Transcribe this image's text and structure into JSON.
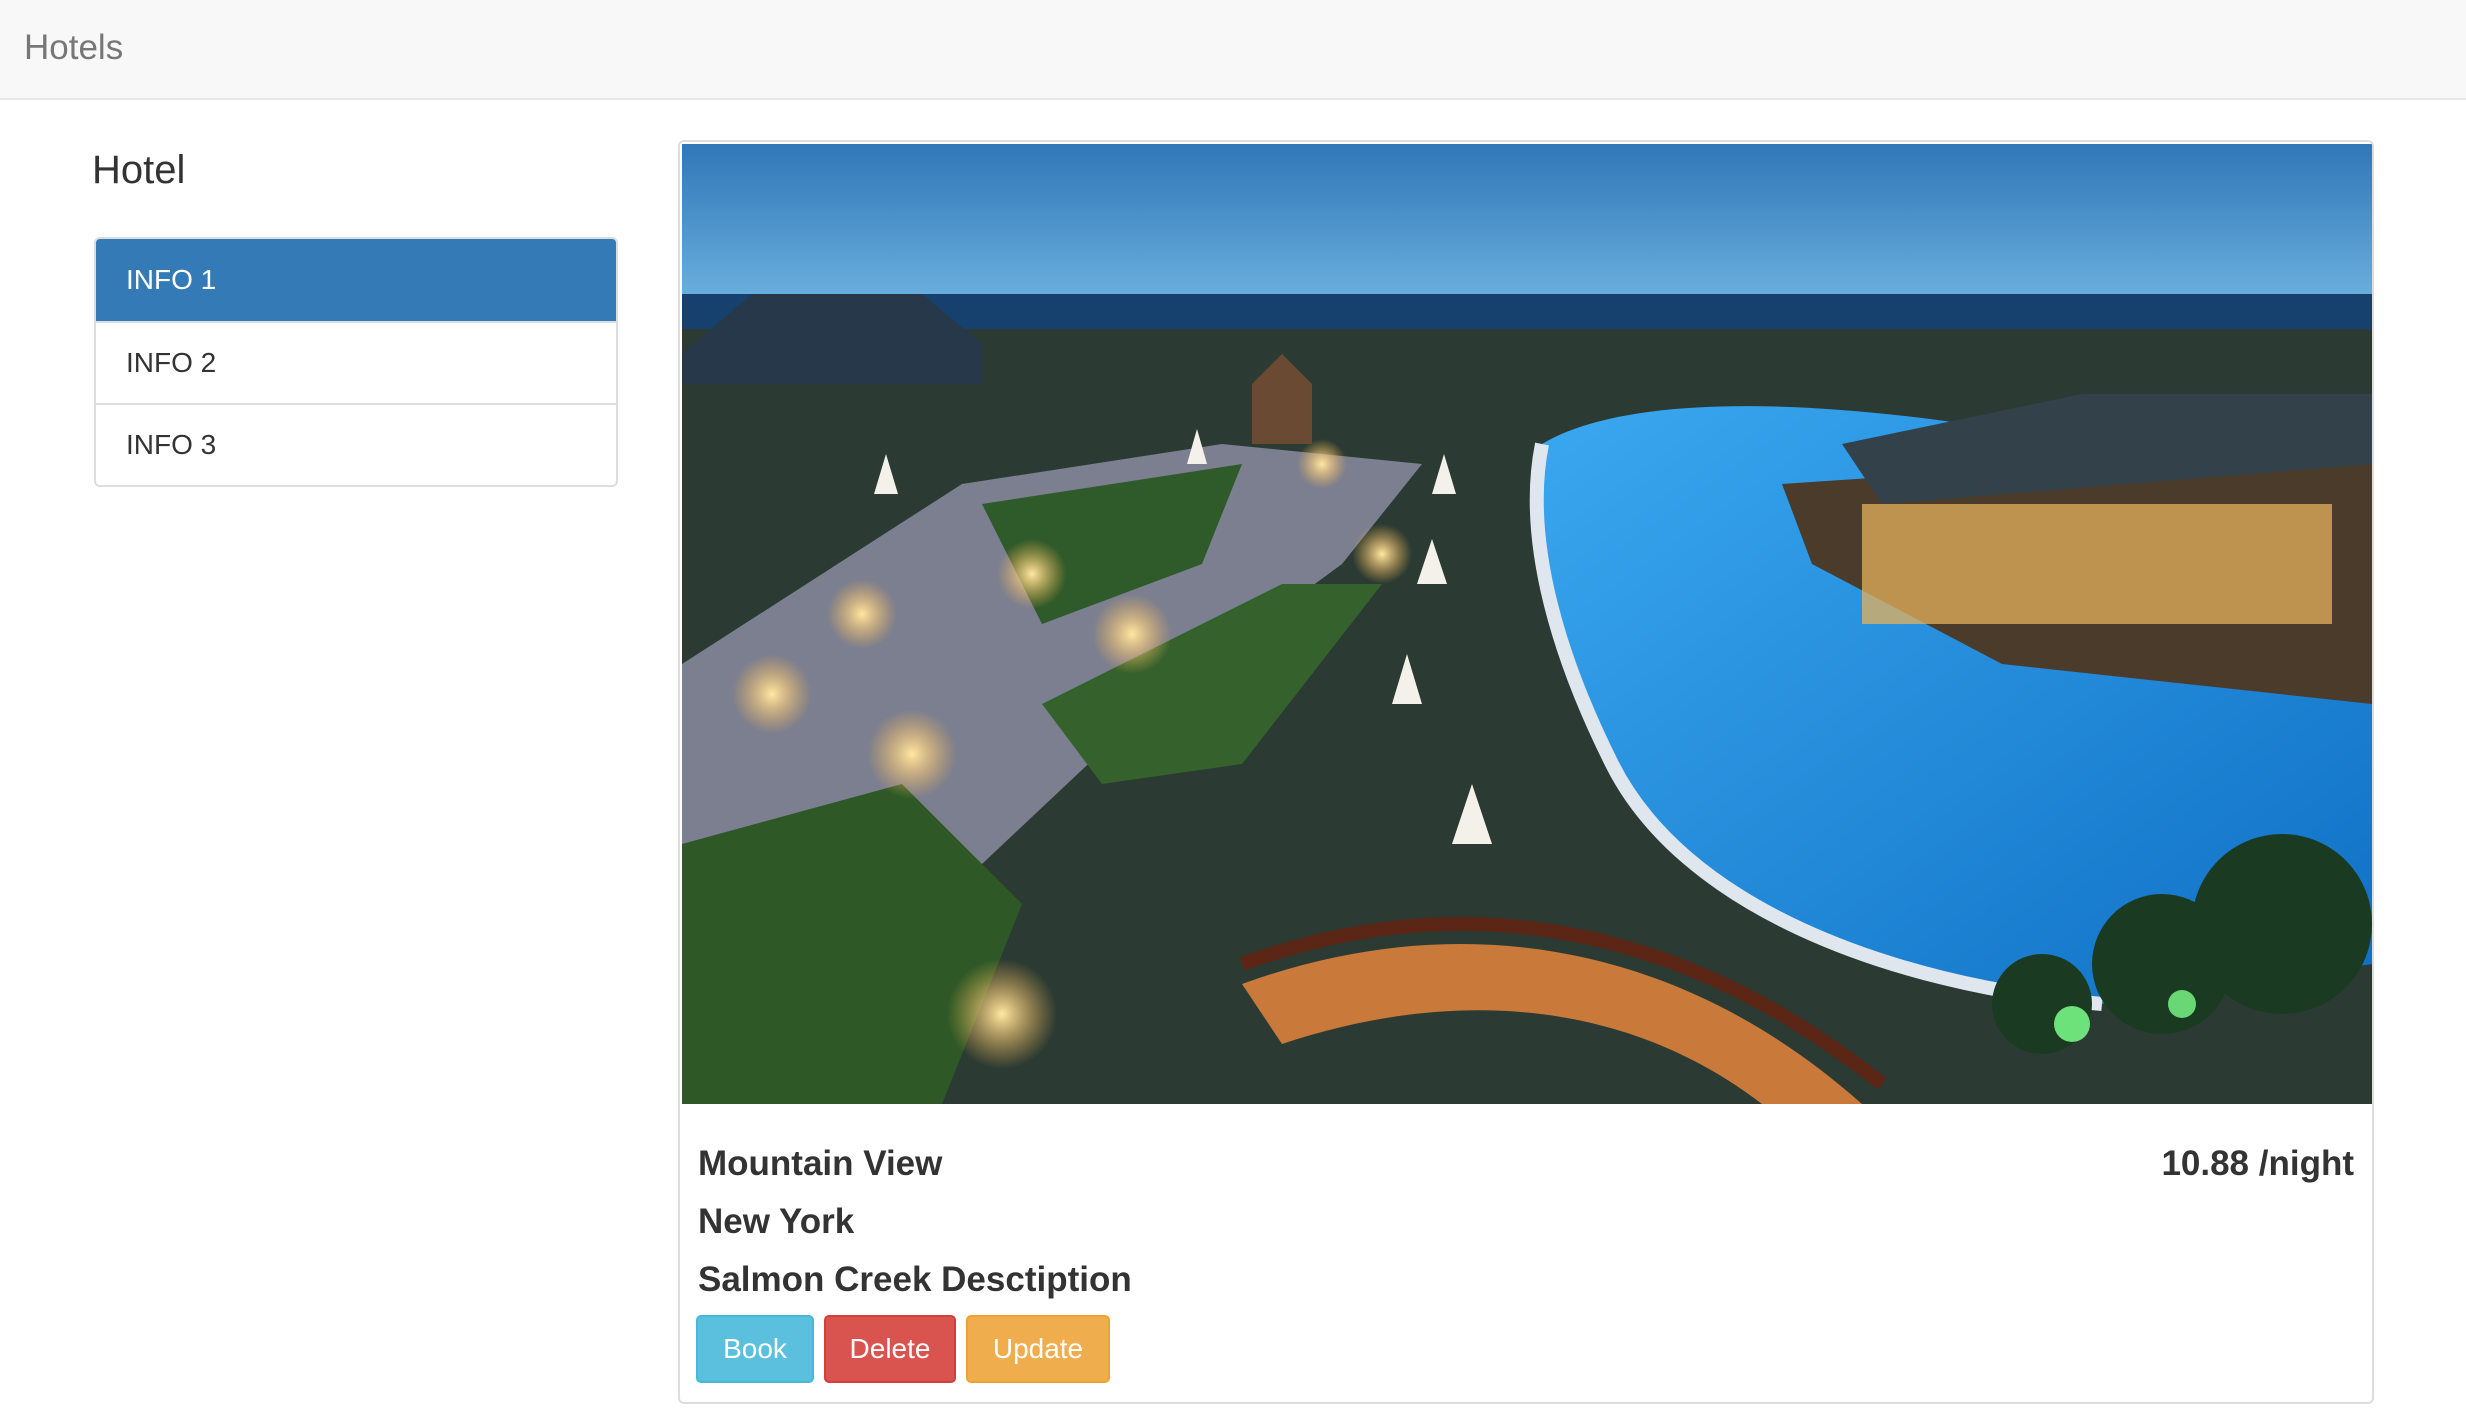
{
  "navbar": {
    "brand": "Hotels"
  },
  "sidebar": {
    "title": "Hotel",
    "items": [
      {
        "label": "INFO 1",
        "active": true
      },
      {
        "label": "INFO 2",
        "active": false
      },
      {
        "label": "INFO 3",
        "active": false
      }
    ]
  },
  "hotel": {
    "name": "Mountain View",
    "city": "New York",
    "description": "Salmon Creek Desctiption",
    "price": "10.88 /night",
    "actions": {
      "book": "Book",
      "delete": "Delete",
      "update": "Update"
    }
  },
  "colors": {
    "active": "#337ab7",
    "book": "#5bc0de",
    "delete": "#d9534f",
    "update": "#f0ad4e"
  }
}
